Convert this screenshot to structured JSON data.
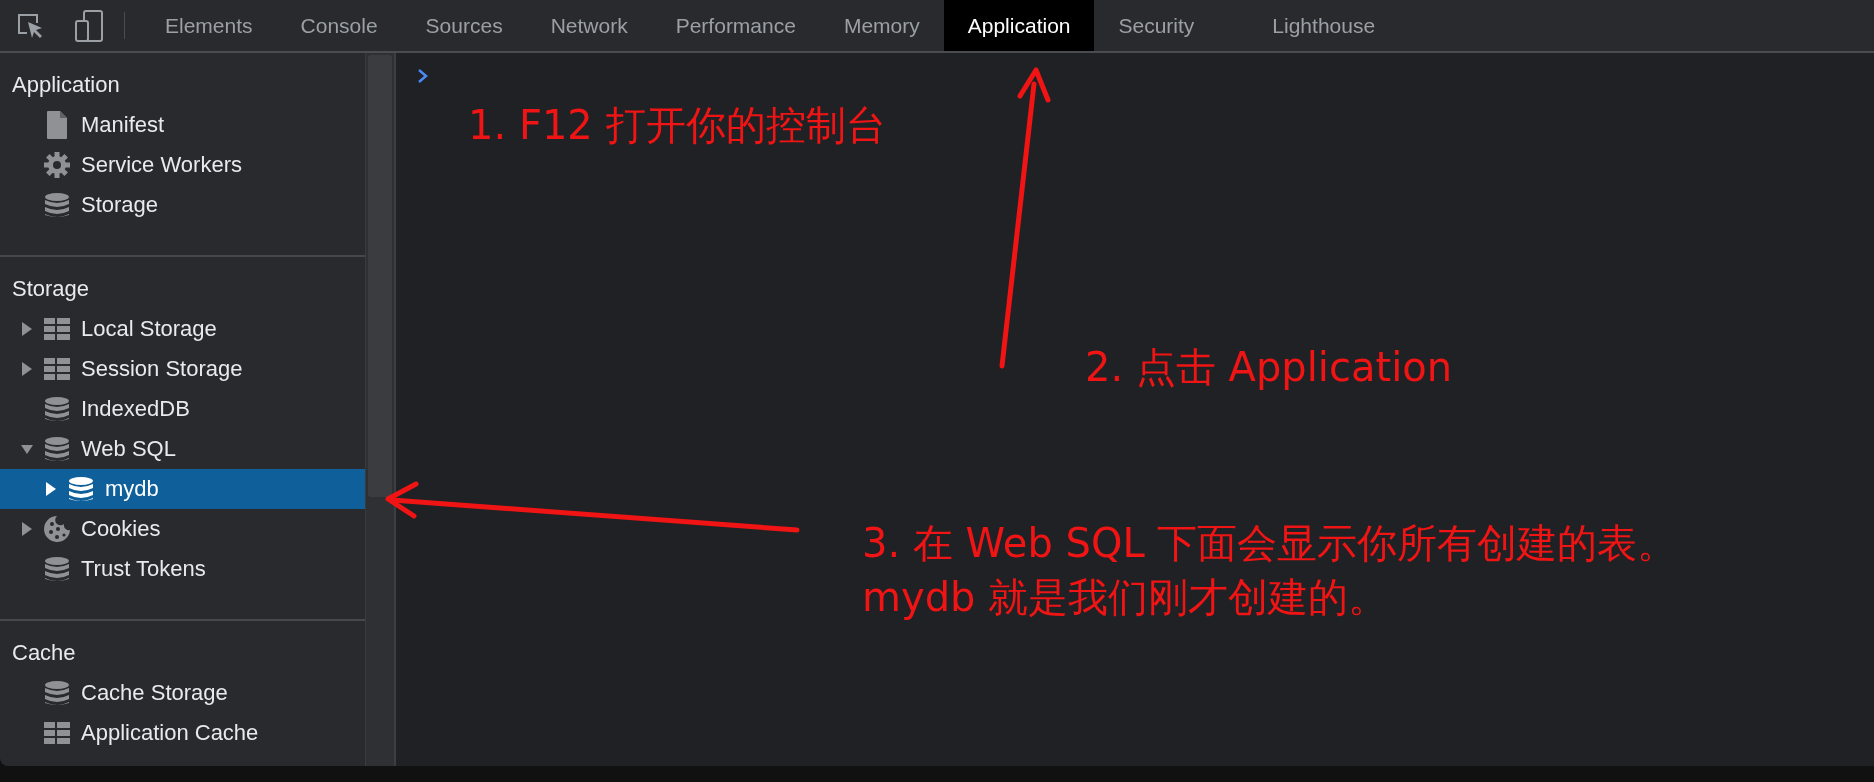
{
  "tabs": [
    {
      "label": "Elements",
      "selected": false
    },
    {
      "label": "Console",
      "selected": false
    },
    {
      "label": "Sources",
      "selected": false
    },
    {
      "label": "Network",
      "selected": false
    },
    {
      "label": "Performance",
      "selected": false
    },
    {
      "label": "Memory",
      "selected": false
    },
    {
      "label": "Application",
      "selected": true
    },
    {
      "label": "Security",
      "selected": false
    },
    {
      "label": "Lighthouse",
      "selected": false
    }
  ],
  "sidebar": {
    "sections": [
      {
        "title": "Application",
        "items": [
          {
            "label": "Manifest",
            "kind": "document",
            "selected": false
          },
          {
            "label": "Service Workers",
            "kind": "service-worker",
            "selected": false
          },
          {
            "label": "Storage",
            "kind": "database",
            "selected": false
          }
        ]
      },
      {
        "title": "Storage",
        "items": [
          {
            "label": "Local Storage",
            "kind": "table",
            "selected": false,
            "expanded": false
          },
          {
            "label": "Session Storage",
            "kind": "table",
            "selected": false,
            "expanded": false
          },
          {
            "label": "IndexedDB",
            "kind": "database",
            "selected": false
          },
          {
            "label": "Web SQL",
            "kind": "database",
            "selected": false,
            "expanded": true,
            "children": [
              {
                "label": "mydb",
                "kind": "database",
                "selected": true,
                "expanded": false
              }
            ]
          },
          {
            "label": "Cookies",
            "kind": "cookie",
            "selected": false,
            "expanded": false
          },
          {
            "label": "Trust Tokens",
            "kind": "database",
            "selected": false
          }
        ]
      },
      {
        "title": "Cache",
        "items": [
          {
            "label": "Cache Storage",
            "kind": "database",
            "selected": false
          },
          {
            "label": "Application Cache",
            "kind": "table",
            "selected": false
          }
        ]
      }
    ]
  },
  "annotations": [
    {
      "lines": [
        "1. F12 打开你的控制台"
      ]
    },
    {
      "lines": [
        "2. 点击 Application"
      ]
    },
    {
      "lines": [
        "3. 在 Web SQL 下面会显示你所有创建的表。",
        "mydb 就是我们刚才创建的。"
      ]
    }
  ]
}
